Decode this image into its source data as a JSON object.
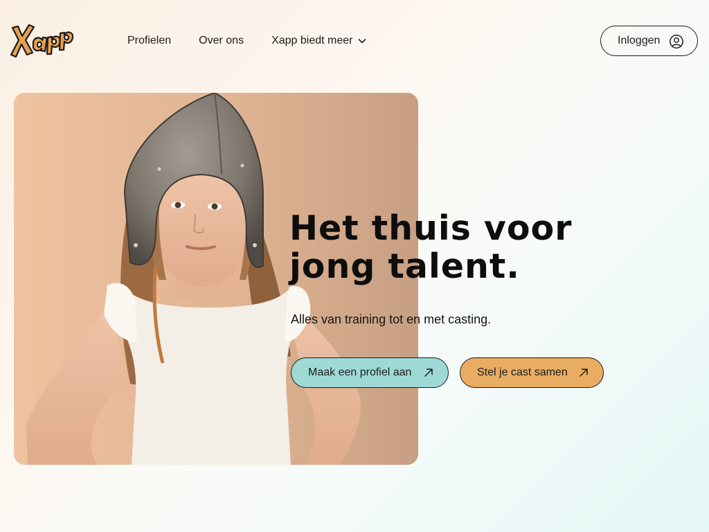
{
  "brand": {
    "logo_text": "Xapp",
    "logo_color": "#e8a14e"
  },
  "nav": {
    "items": [
      {
        "label": "Profielen"
      },
      {
        "label": "Over ons"
      },
      {
        "label": "Xapp biedt meer",
        "icon": "chevron-down-icon"
      }
    ]
  },
  "header": {
    "login_label": "Inloggen",
    "login_icon": "user-circle-icon"
  },
  "hero": {
    "headline_line1": "Het thuis voor",
    "headline_line2": "jong talent.",
    "subline": "Alles van training tot en met casting.",
    "image_subject": "girl-with-helmet-photo"
  },
  "cta": {
    "profile_label": "Maak een profiel aan",
    "profile_color": "#9ed9d6",
    "cast_label": "Stel je cast samen",
    "cast_color": "#e8ac62",
    "icon": "arrow-up-right-icon"
  }
}
